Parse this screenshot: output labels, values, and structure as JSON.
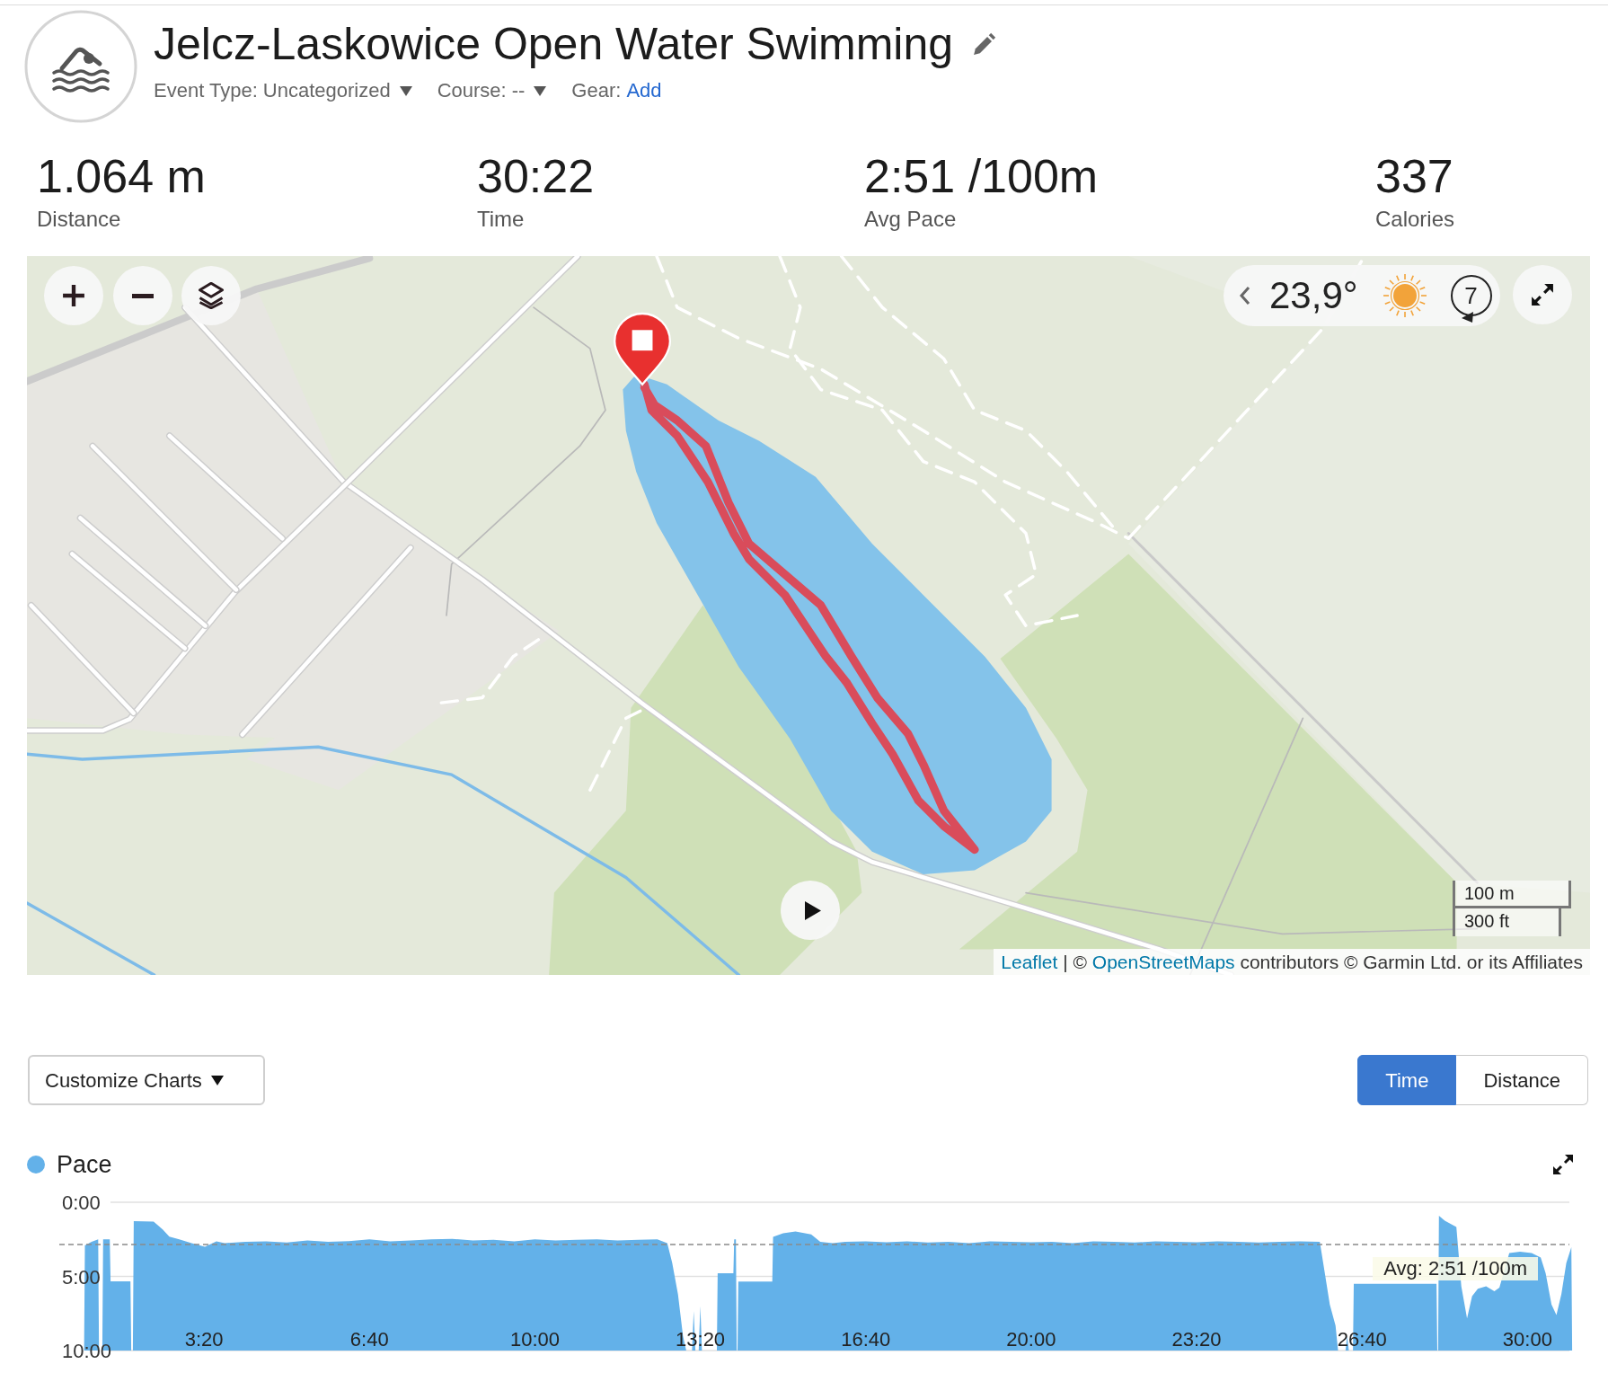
{
  "activity": {
    "title": "Jelcz-Laskowice Open Water Swimming",
    "meta": [
      {
        "kind": "dropdown",
        "label": "Event Type:",
        "value": "Uncategorized"
      },
      {
        "kind": "dropdown",
        "label": "Course:",
        "value": "--"
      },
      {
        "kind": "link",
        "label": "Gear:",
        "value": "Add"
      }
    ]
  },
  "stats": [
    {
      "value": "1.064 m",
      "label": "Distance"
    },
    {
      "value": "30:22",
      "label": "Time"
    },
    {
      "value": "2:51 /100m",
      "label": "Avg Pace"
    },
    {
      "value": "337",
      "label": "Calories"
    }
  ],
  "map": {
    "weather": {
      "temperature": "23,9°",
      "wind_speed": "7"
    },
    "scale": [
      "100 m",
      "300 ft"
    ],
    "attribution": [
      {
        "kind": "link",
        "text": "Leaflet"
      },
      {
        "kind": "text",
        "text": "| ©"
      },
      {
        "kind": "link",
        "text": "OpenStreetMaps"
      },
      {
        "kind": "text",
        "text": "contributors © Garmin Ltd. or its Affiliates"
      }
    ]
  },
  "chart_toolbar": {
    "customize_button": "Customize Charts",
    "x_axis_toggle": [
      {
        "label": "Time",
        "selected": true
      },
      {
        "label": "Distance",
        "selected": false
      }
    ]
  },
  "chart": {
    "average_label": "Avg: 2:51 /100m",
    "chart_data": {
      "type": "area",
      "x": [
        55,
        56,
        64,
        72,
        73,
        77,
        78,
        86,
        87,
        111,
        112,
        114,
        115,
        139,
        150,
        158,
        170,
        185,
        201,
        215,
        225,
        250,
        275,
        300,
        325,
        350,
        375,
        400,
        425,
        450,
        475,
        500,
        525,
        550,
        575,
        600,
        625,
        650,
        675,
        700,
        725,
        748,
        760,
        766,
        773,
        779,
        783,
        790,
        792,
        794,
        798,
        800,
        802,
        820,
        821,
        840,
        841,
        843,
        844,
        845,
        846,
        887,
        888,
        900,
        915,
        934,
        945,
        960,
        975,
        1000,
        1025,
        1050,
        1075,
        1100,
        1125,
        1150,
        1175,
        1200,
        1225,
        1250,
        1275,
        1300,
        1325,
        1350,
        1375,
        1400,
        1425,
        1450,
        1475,
        1500,
        1525,
        1549,
        1555,
        1561,
        1568,
        1571,
        1580,
        1582,
        1584,
        1589,
        1590,
        1690,
        1691,
        1692,
        1693,
        1700,
        1714,
        1720,
        1727,
        1733,
        1740,
        1750,
        1760,
        1766,
        1778,
        1791,
        1805,
        1816,
        1822,
        1829,
        1835,
        1841,
        1847,
        1853,
        1854
      ],
      "series": [
        {
          "name": "Pace",
          "color": "#63b1e9",
          "values": [
            600,
            175,
            160,
            150,
            600,
            600,
            150,
            150,
            320,
            320,
            600,
            600,
            76,
            78,
            110,
            139,
            150,
            165,
            180,
            158,
            165,
            160,
            158,
            163,
            155,
            160,
            157,
            150,
            158,
            155,
            150,
            148,
            155,
            152,
            158,
            150,
            155,
            152,
            150,
            155,
            152,
            150,
            165,
            245,
            372,
            541,
            600,
            600,
            440,
            600,
            600,
            420,
            600,
            600,
            287,
            287,
            150,
            150,
            600,
            600,
            321,
            321,
            140,
            125,
            118,
            130,
            160,
            165,
            160,
            158,
            162,
            158,
            163,
            160,
            165,
            158,
            160,
            162,
            160,
            165,
            158,
            160,
            163,
            158,
            160,
            162,
            158,
            160,
            163,
            160,
            158,
            160,
            287,
            414,
            499,
            600,
            600,
            540,
            600,
            600,
            330,
            330,
            600,
            600,
            55,
            75,
            100,
            340,
            470,
            380,
            350,
            340,
            360,
            345,
            205,
            200,
            205,
            224,
            287,
            414,
            456,
            372,
            245,
            182,
            600
          ]
        }
      ],
      "xlim": [
        25,
        1855
      ],
      "ylim": [
        600,
        0
      ],
      "xticks": [
        {
          "value": 200,
          "label": "3:20"
        },
        {
          "value": 400,
          "label": "6:40"
        },
        {
          "value": 600,
          "label": "10:00"
        },
        {
          "value": 800,
          "label": "13:20"
        },
        {
          "value": 1000,
          "label": "16:40"
        },
        {
          "value": 1200,
          "label": "20:00"
        },
        {
          "value": 1400,
          "label": "23:20"
        },
        {
          "value": 1600,
          "label": "26:40"
        },
        {
          "value": 1800,
          "label": "30:00"
        }
      ],
      "yticks": [
        {
          "value": 0,
          "label": "0:00"
        },
        {
          "value": 300,
          "label": "5:00"
        },
        {
          "value": 600,
          "label": "10:00"
        }
      ],
      "ref_lines": [
        {
          "axis": "y",
          "value": 171
        }
      ]
    }
  }
}
